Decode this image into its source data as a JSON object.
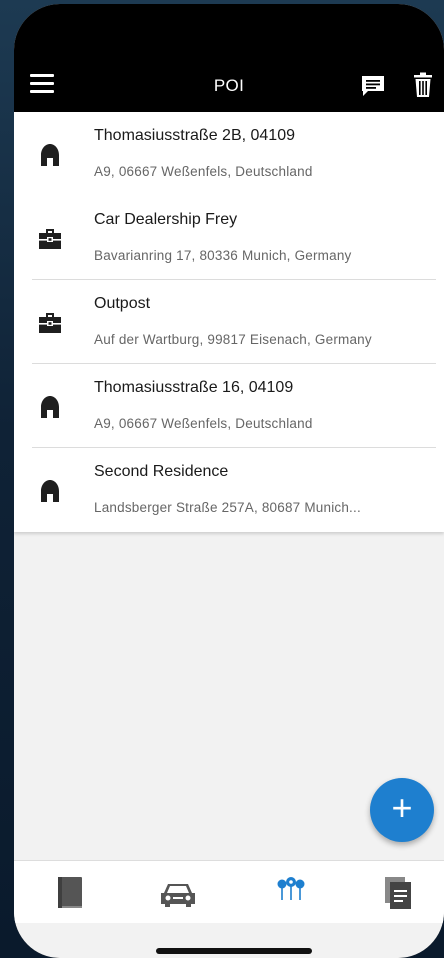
{
  "appbar": {
    "title": "POI"
  },
  "pois": [
    {
      "icon": "home-icon",
      "name": "Thomasiusstraße 2B, 04109",
      "address": "A9, 06667 Weßenfels, Deutschland"
    },
    {
      "icon": "toolbox-icon",
      "name": "Car Dealership Frey",
      "address": "Bavarianring 17, 80336 Munich, Germany"
    },
    {
      "icon": "toolbox-icon",
      "name": "Outpost",
      "address": "Auf der Wartburg, 99817 Eisenach, Germany"
    },
    {
      "icon": "home-icon",
      "name": "Thomasiusstraße 16, 04109",
      "address": "A9, 06667 Weßenfels, Deutschland"
    },
    {
      "icon": "home-icon",
      "name": "Second Residence",
      "address": "Landsberger Straße 257A, 80687 Munich..."
    }
  ],
  "fab": {
    "label": "+"
  },
  "tabs": [
    {
      "icon": "book-icon",
      "active": false
    },
    {
      "icon": "car-icon",
      "active": false
    },
    {
      "icon": "poi-pins-icon",
      "active": true
    },
    {
      "icon": "documents-icon",
      "active": false
    }
  ],
  "colors": {
    "accent": "#1e7fcf",
    "appbar": "#000000",
    "icon_dark": "#1f1f1f",
    "tab_inactive": "#555555"
  }
}
